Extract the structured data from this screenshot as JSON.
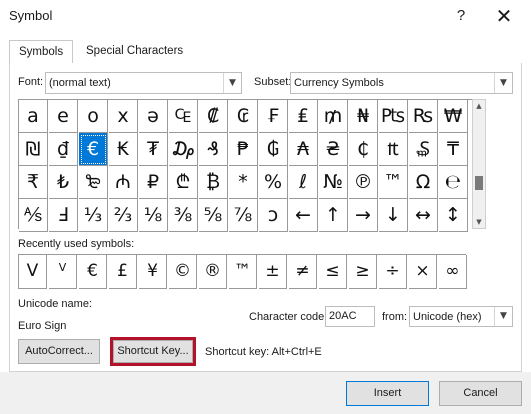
{
  "window": {
    "title": "Symbol",
    "help_label": "?",
    "close_label": "✕"
  },
  "tabs": [
    {
      "label": "Symbols"
    },
    {
      "label": "Special Characters"
    }
  ],
  "font": {
    "label": "Font:",
    "value": "(normal text)"
  },
  "subset": {
    "label": "Subset:",
    "value": "Currency Symbols"
  },
  "symbol_grid": [
    [
      "a",
      "e",
      "o",
      "x",
      "ə",
      "₠",
      "₡",
      "₢",
      "₣",
      "₤",
      "₥",
      "₦",
      "₧",
      "₨",
      "₩"
    ],
    [
      "₪",
      "₫",
      "€",
      "₭",
      "₮",
      "₯",
      "₰",
      "₱",
      "₲",
      "₳",
      "₴",
      "₵",
      "₶",
      "₷",
      "₸"
    ],
    [
      "₹",
      "₺",
      "₻",
      "₼",
      "₽",
      "₾",
      "₿",
      "*",
      "%",
      "ℓ",
      "№",
      "℗",
      "™",
      "Ω",
      "℮"
    ],
    [
      "⅍",
      "Ⅎ",
      "⅓",
      "⅔",
      "⅛",
      "⅜",
      "⅝",
      "⅞",
      "ↄ",
      "←",
      "↑",
      "→",
      "↓",
      "↔",
      "↕"
    ]
  ],
  "selected_symbol": {
    "row": 1,
    "col": 2
  },
  "recently_used": {
    "label": "Recently used symbols:",
    "items": [
      "V",
      "V",
      "€",
      "£",
      "¥",
      "©",
      "®",
      "™",
      "±",
      "≠",
      "≤",
      "≥",
      "÷",
      "×",
      "∞"
    ]
  },
  "unicode_name": {
    "label": "Unicode name:",
    "value": "Euro Sign"
  },
  "character_code": {
    "label": "Character code:",
    "value": "20AC"
  },
  "from": {
    "label": "from:",
    "value": "Unicode (hex)"
  },
  "buttons": {
    "autocorrect": "AutoCorrect...",
    "shortcut_key": "Shortcut Key...",
    "insert": "Insert",
    "cancel": "Cancel"
  },
  "shortcut_text": "Shortcut key: Alt+Ctrl+E",
  "colors": {
    "selection": "#0078d7",
    "highlight": "#b3122a"
  }
}
